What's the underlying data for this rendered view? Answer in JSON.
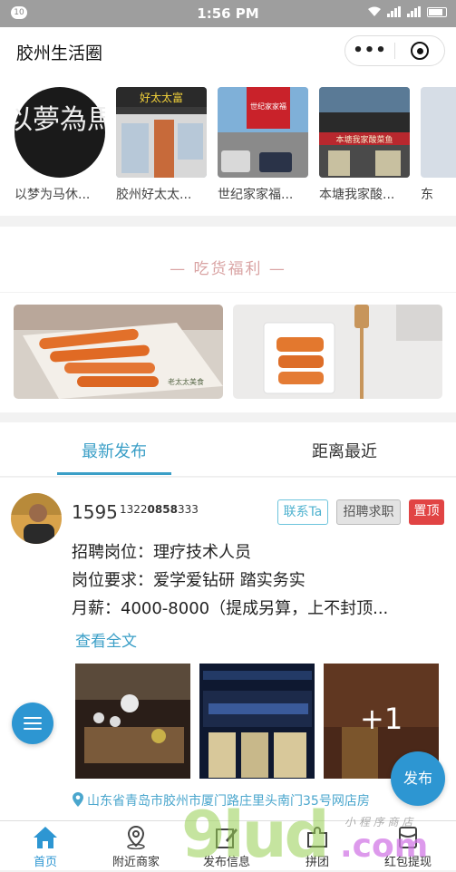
{
  "status_bar": {
    "notification_count": "10",
    "time": "1:56 PM"
  },
  "header": {
    "title": "胶州生活圈",
    "more_label": "•••"
  },
  "shops": [
    {
      "name": "以梦为马休...",
      "logo_text": "以夢為馬"
    },
    {
      "name": "胶州好太太...",
      "sign_text": "好太太富"
    },
    {
      "name": "世纪家家福...",
      "sign_text": "世纪家家福"
    },
    {
      "name": "本塘我家酸...",
      "sign_text": "本塘我家酸菜鱼"
    },
    {
      "name": "东"
    }
  ],
  "foodie": {
    "label": "—  吃货福利  —",
    "banner_text": "老太太美食"
  },
  "tabs": [
    {
      "label": "最新发布"
    },
    {
      "label": "距离最近"
    }
  ],
  "post": {
    "username": "1595",
    "phone": "1322",
    "phone_bold": "0858",
    "phone_tail": "333",
    "chips": {
      "contact": "联系Ta",
      "category": "招聘求职",
      "pin": "置顶"
    },
    "lines": [
      "招聘岗位：理疗技术人员",
      "岗位要求：爱学爱钻研 踏实务实",
      "月薪：4000-8000（提成另算，上不封顶..."
    ],
    "read_more": "查看全文",
    "extra_images": "+1",
    "address": "山东省青岛市胶州市厦门路庄里头南门35号网店房"
  },
  "fab": {
    "post_label": "发布"
  },
  "tabbar": [
    {
      "label": "首页"
    },
    {
      "label": "附近商家"
    },
    {
      "label": "发布信息"
    },
    {
      "label": "拼团"
    },
    {
      "label": "红包提现"
    }
  ],
  "watermark": {
    "main": "9lud",
    "domain": ".com",
    "sub": "小 程 序 商 店"
  }
}
